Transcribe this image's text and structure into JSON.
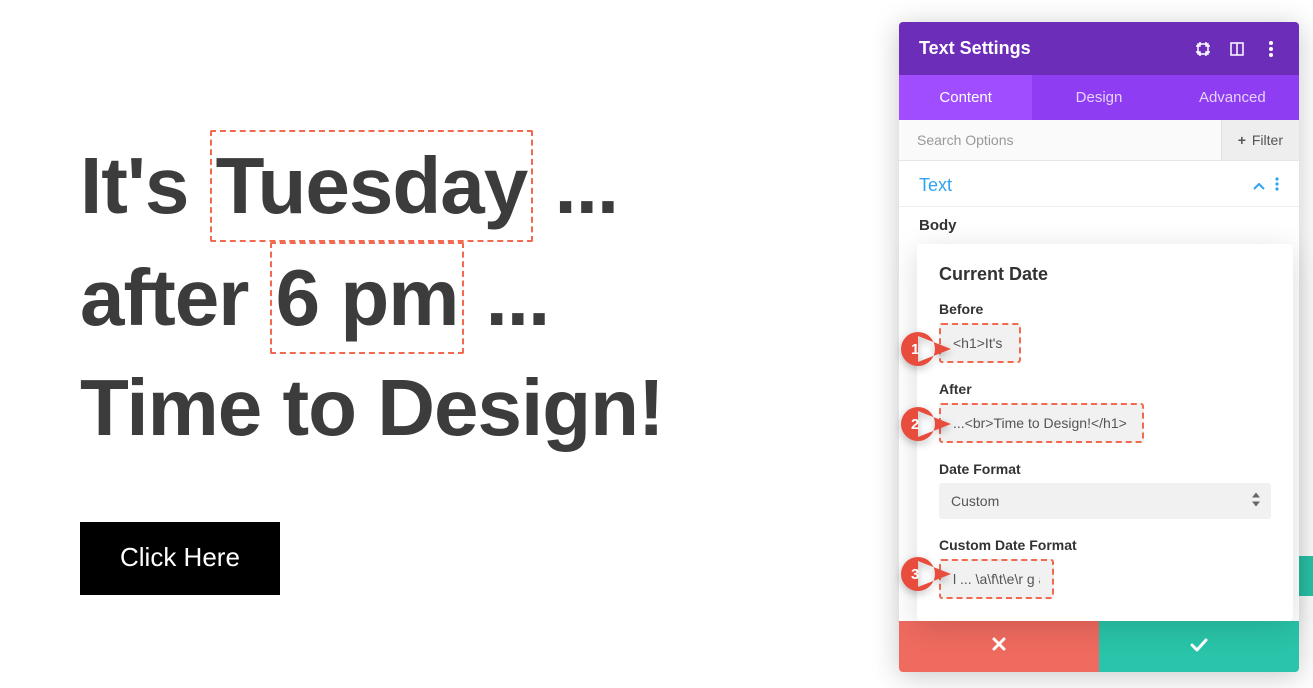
{
  "preview": {
    "line1_pre": "It's ",
    "line1_hl": "Tuesday",
    "line1_post": " ...",
    "line2_pre": "after ",
    "line2_hl": "6 pm",
    "line2_post": " ...",
    "line3": "Time to Design!",
    "cta_label": "Click Here"
  },
  "panel": {
    "title": "Text Settings",
    "tabs": {
      "content": "Content",
      "design": "Design",
      "advanced": "Advanced"
    },
    "search_placeholder": "Search Options",
    "filter_label": "Filter",
    "section_title": "Text",
    "body_label": "Body"
  },
  "card": {
    "title": "Current Date",
    "before_label": "Before",
    "before_value": "<h1>It's",
    "after_label": "After",
    "after_value": "...<br>Time to Design!</h1>",
    "date_format_label": "Date Format",
    "date_format_value": "Custom",
    "custom_format_label": "Custom Date Format",
    "custom_format_value": "l ... \\a\\f\\t\\e\\r g a"
  },
  "callouts": {
    "c1": "1",
    "c2": "2",
    "c3": "3"
  }
}
